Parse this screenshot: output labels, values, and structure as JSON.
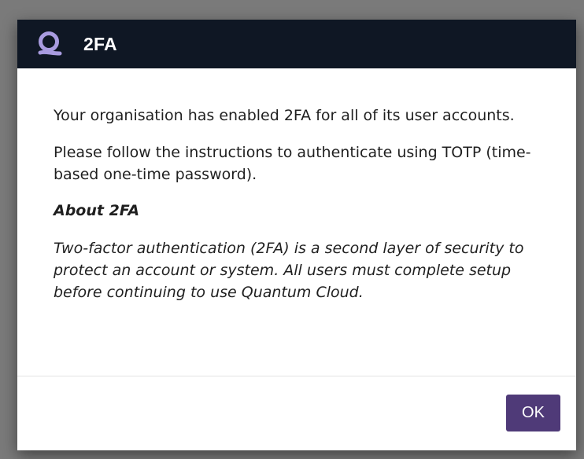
{
  "dialog": {
    "title": "2FA",
    "logo_icon": "quantum-logo-icon",
    "body": {
      "paragraph_1": "Your organisation has enabled 2FA for all of its user accounts.",
      "paragraph_2": "Please follow the instructions to authenticate using TOTP (time-based one-time password).",
      "about_heading": "About 2FA",
      "about_text": "Two-factor authentication (2FA) is a second layer of security to protect an account or system. All users must complete setup before continuing to use Quantum Cloud."
    },
    "ok_label": "OK"
  },
  "colors": {
    "header_background": "#0f1724",
    "logo_accent": "#a99ce0",
    "button_background": "#4f3a78",
    "backdrop": "#7a7a7a"
  }
}
